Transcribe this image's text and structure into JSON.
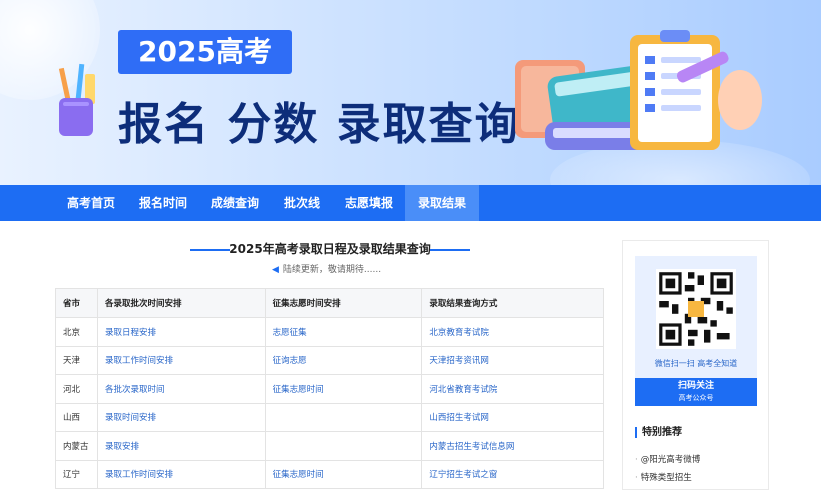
{
  "banner": {
    "year_tag": "2025高考",
    "headline": "报名 分数 录取查询"
  },
  "nav": {
    "items": [
      {
        "label": "高考首页"
      },
      {
        "label": "报名时间"
      },
      {
        "label": "成绩查询"
      },
      {
        "label": "批次线"
      },
      {
        "label": "志愿填报"
      },
      {
        "label": "录取结果"
      }
    ],
    "active": "录取结果"
  },
  "main": {
    "title": "2025年高考录取日程及录取结果查询",
    "notice": "陆续更新，敬请期待......",
    "table": {
      "headers": [
        "省市",
        "各录取批次时间安排",
        "征集志愿时间安排",
        "录取结果查询方式"
      ],
      "rows": [
        [
          "北京",
          "录取日程安排",
          "志愿征集",
          "北京教育考试院"
        ],
        [
          "天津",
          "录取工作时间安排",
          "征询志愿",
          "天津招考资讯网"
        ],
        [
          "河北",
          "各批次录取时间",
          "征集志愿时间",
          "河北省教育考试院"
        ],
        [
          "山西",
          "录取时间安排",
          "",
          "山西招生考试网"
        ],
        [
          "内蒙古",
          "录取安排",
          "",
          "内蒙古招生考试信息网"
        ],
        [
          "辽宁",
          "录取工作时间安排",
          "征集志愿时间",
          "辽宁招生考试之窗"
        ]
      ]
    }
  },
  "sidebar": {
    "qr_caption": "微信扫一扫 高考全知道",
    "follow_main": "扫码关注",
    "follow_sub": "高考公众号",
    "section_title": "特别推荐",
    "recommendations": [
      {
        "label": "@阳光高考微博"
      },
      {
        "label": "特殊类型招生"
      }
    ]
  },
  "colors": {
    "brand_blue": "#1d6df3",
    "link_blue": "#2a67c9",
    "headline": "#0d2d7a"
  }
}
